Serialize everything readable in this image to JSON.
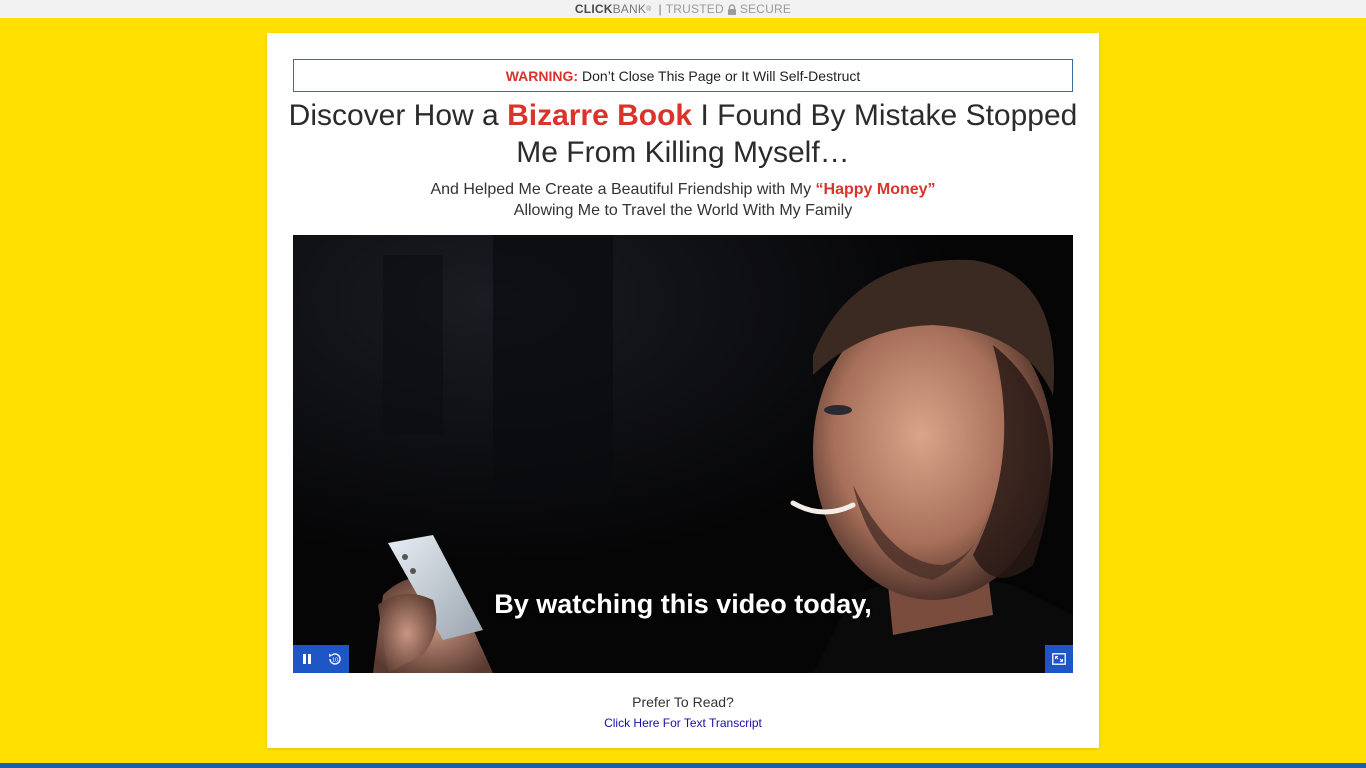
{
  "topbar": {
    "brand_click": "CLICK",
    "brand_bank": "BANK",
    "registered": "®",
    "separator": "|",
    "trusted": "TRUSTED",
    "secure": "SECURE",
    "lock_icon": "lock-icon"
  },
  "warning": {
    "label": "WARNING:",
    "text": "Don’t Close This Page or It Will Self-Destruct"
  },
  "headline": {
    "part1": "Discover How a",
    "highlight": "Bizarre Book",
    "part2": "I Found By Mistake Stopped Me From Killing Myself…"
  },
  "subhead": {
    "line1_part1": "And Helped Me Create a Beautiful Friendship with My",
    "line1_highlight": "“Happy Money”",
    "line2": "Allowing Me to Travel the World With My Family"
  },
  "video": {
    "caption": "By watching this video today,",
    "controls": {
      "pause_icon": "pause-icon",
      "replay_icon": "replay-10-icon",
      "replay_label": "10",
      "fullscreen_icon": "fullscreen-icon"
    }
  },
  "read_option": {
    "prompt": "Prefer To Read?",
    "link": "Click Here For Text Transcript"
  },
  "colors": {
    "page_background": "#FFE000",
    "accent_red": "#D9332B",
    "player_blue": "#1E56C6",
    "bottom_bar": "#1F5FA8",
    "link_blue": "#1A0DAB"
  }
}
